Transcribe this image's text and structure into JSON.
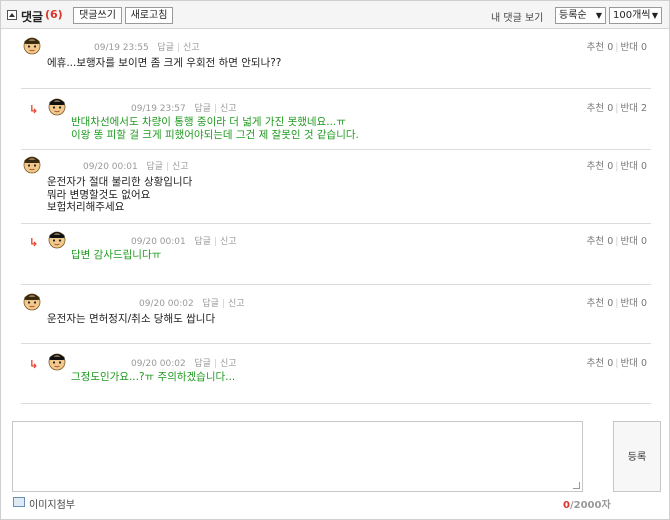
{
  "header": {
    "title": "댓글",
    "count": "(6)",
    "write_button": "댓글쓰기",
    "refresh_button": "새로고침",
    "my_comments": "내 댓글 보기",
    "order_select": "등록순",
    "per_page_select": "100개씩"
  },
  "labels": {
    "reply": "답글",
    "report": "신고",
    "recommend": "추천",
    "oppose": "반대",
    "reply_arrow": "↳"
  },
  "comments": [
    {
      "time": "09/19 23:55",
      "lines": [
        "에휴...보행자를 보이면 좀 크게 우회전 하면 안되나??"
      ],
      "recommend": "0",
      "oppose": "0",
      "reply": false
    },
    {
      "time": "09/19 23:57",
      "lines": [
        "반대차선에서도 차량이 통행 중이라 더 넓게 가진 못했네요...ㅠ",
        "이왕 똥 피할 걸 크게 피했어야되는데 그건 제 잘못인 것 같습니다."
      ],
      "recommend": "0",
      "oppose": "2",
      "reply": true
    },
    {
      "time": "09/20 00:01",
      "lines": [
        "운전자가 절대 불리한 상황입니다",
        "뭐라 변명할것도 없어요",
        "보험처리해주세요"
      ],
      "recommend": "0",
      "oppose": "0",
      "reply": false
    },
    {
      "time": "09/20 00:01",
      "lines": [
        "답변 감사드립니다ㅠ"
      ],
      "recommend": "0",
      "oppose": "0",
      "reply": true
    },
    {
      "time": "09/20 00:02",
      "lines": [
        "운전자는 면허정지/취소 당해도 쌉니다"
      ],
      "recommend": "0",
      "oppose": "0",
      "reply": false
    },
    {
      "time": "09/20 00:02",
      "lines": [
        "그정도인가요...?ㅠ 주의하겠습니다..."
      ],
      "recommend": "0",
      "oppose": "0",
      "reply": true
    }
  ],
  "form": {
    "submit_label": "등록",
    "image_attach": "이미지첨부",
    "char_count": "0",
    "char_max": "/2000자"
  },
  "colors": {
    "reply_text": "#1f9a1f",
    "count_red": "#d9342b"
  }
}
